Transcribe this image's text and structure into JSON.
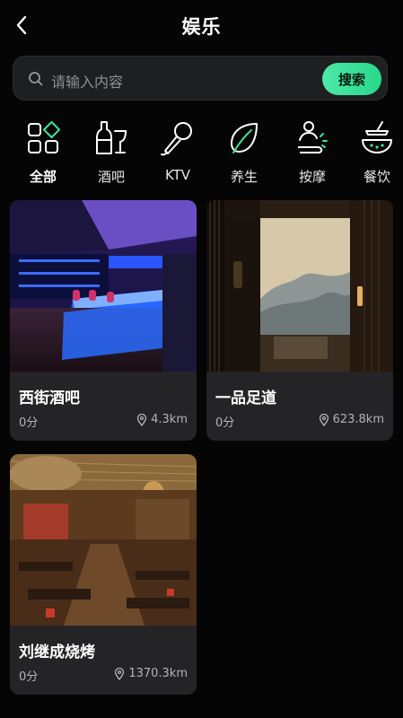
{
  "header": {
    "title": "娱乐"
  },
  "search": {
    "placeholder": "请输入内容",
    "button_label": "搜索"
  },
  "categories": [
    {
      "label": "全部",
      "icon": "grid-apps-icon",
      "active": true
    },
    {
      "label": "酒吧",
      "icon": "bottle-glass-icon",
      "active": false
    },
    {
      "label": "KTV",
      "icon": "microphone-icon",
      "active": false
    },
    {
      "label": "养生",
      "icon": "leaf-icon",
      "active": false
    },
    {
      "label": "按摩",
      "icon": "massage-icon",
      "active": false
    },
    {
      "label": "餐饮",
      "icon": "food-icon",
      "active": false
    }
  ],
  "venues": [
    {
      "name": "西街酒吧",
      "score": "0分",
      "distance": "4.3km",
      "image": "bar-interior-photo"
    },
    {
      "name": "一品足道",
      "score": "0分",
      "distance": "623.8km",
      "image": "spa-lobby-photo"
    },
    {
      "name": "刘继成烧烤",
      "score": "0分",
      "distance": "1370.3km",
      "image": "restaurant-interior-photo"
    }
  ],
  "colors": {
    "background": "#050505",
    "accent": "#28d889",
    "card": "#242427"
  }
}
